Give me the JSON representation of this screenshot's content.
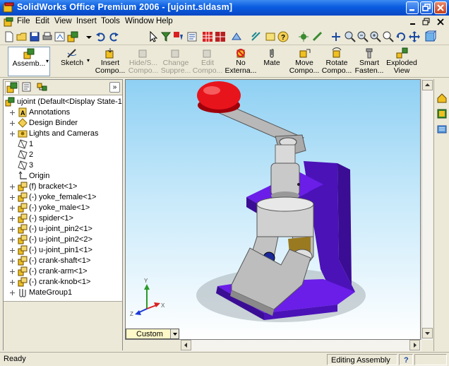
{
  "window": {
    "title": "SolidWorks Office Premium 2006 - [ujoint.sldasm]"
  },
  "menu": [
    "File",
    "Edit",
    "View",
    "Insert",
    "Tools",
    "Window",
    "Help"
  ],
  "command_manager": {
    "items": [
      {
        "label1": "Assemb...",
        "label2": "",
        "enabled": true
      },
      {
        "label1": "Sketch",
        "label2": "",
        "enabled": true
      },
      {
        "label1": "Insert",
        "label2": "Compo...",
        "enabled": true
      },
      {
        "label1": "Hide/S...",
        "label2": "Compo...",
        "enabled": false
      },
      {
        "label1": "Change",
        "label2": "Suppre...",
        "enabled": false
      },
      {
        "label1": "Edit",
        "label2": "Compo...",
        "enabled": false
      },
      {
        "label1": "No",
        "label2": "Externa...",
        "enabled": true
      },
      {
        "label1": "Mate",
        "label2": "",
        "enabled": true
      },
      {
        "label1": "Move",
        "label2": "Compo...",
        "enabled": true
      },
      {
        "label1": "Rotate",
        "label2": "Compo...",
        "enabled": true
      },
      {
        "label1": "Smart",
        "label2": "Fasten...",
        "enabled": true
      },
      {
        "label1": "Exploded",
        "label2": "View",
        "enabled": true
      }
    ]
  },
  "feature_tree": {
    "root": "ujoint  (Default<Display State-1",
    "items": [
      {
        "label": "Annotations",
        "icon": "annotations-icon",
        "expand": true
      },
      {
        "label": "Design Binder",
        "icon": "design-binder-icon",
        "expand": true
      },
      {
        "label": "Lights and Cameras",
        "icon": "lights-cameras-icon",
        "expand": true
      },
      {
        "label": "1",
        "icon": "plane-icon",
        "expand": false
      },
      {
        "label": "2",
        "icon": "plane-icon",
        "expand": false
      },
      {
        "label": "3",
        "icon": "plane-icon",
        "expand": false
      },
      {
        "label": "Origin",
        "icon": "origin-icon",
        "expand": false
      },
      {
        "label": "(f) bracket<1>",
        "icon": "part-icon",
        "expand": true
      },
      {
        "label": "(-) yoke_female<1>",
        "icon": "part-icon",
        "expand": true
      },
      {
        "label": "(-) yoke_male<1>",
        "icon": "part-icon",
        "expand": true
      },
      {
        "label": "(-) spider<1>",
        "icon": "part-icon",
        "expand": true
      },
      {
        "label": "(-) u-joint_pin2<1>",
        "icon": "part-icon",
        "expand": true
      },
      {
        "label": "(-) u-joint_pin2<2>",
        "icon": "part-icon",
        "expand": true
      },
      {
        "label": "(-) u-joint_pin1<1>",
        "icon": "part-icon",
        "expand": true
      },
      {
        "label": "(-) crank-shaft<1>",
        "icon": "part-icon",
        "expand": true
      },
      {
        "label": "(-) crank-arm<1>",
        "icon": "part-icon",
        "expand": true
      },
      {
        "label": "(-) crank-knob<1>",
        "icon": "part-icon",
        "expand": true
      },
      {
        "label": "MateGroup1",
        "icon": "mategroup-icon",
        "expand": true
      }
    ]
  },
  "view": {
    "orientation": "Custom",
    "axes": [
      "X",
      "Y",
      "Z"
    ]
  },
  "status": {
    "left": "Ready",
    "mode": "Editing Assembly",
    "help": "?"
  },
  "colors": {
    "titlebar": "#0a5ce0",
    "bracket": "#6a1ee8",
    "knob": "#e8141c",
    "background_top": "#8fd0f3",
    "viewcombo": "#fff8c8"
  }
}
